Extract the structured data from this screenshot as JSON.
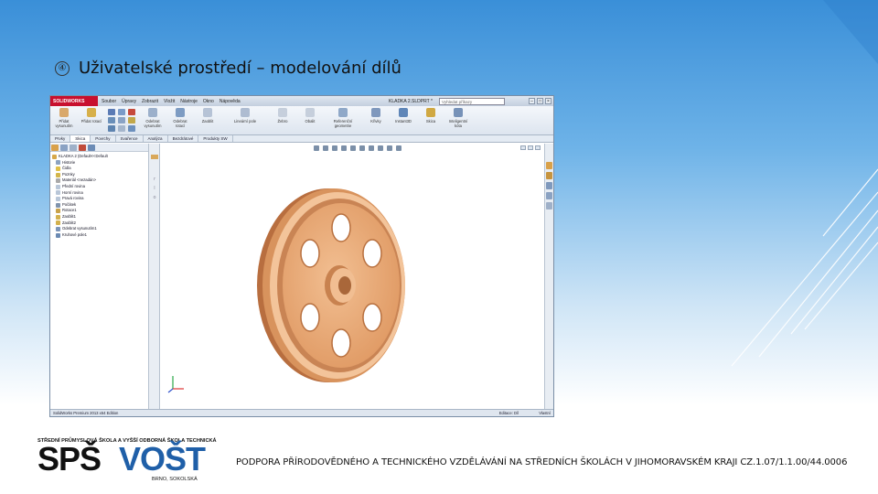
{
  "slide": {
    "bullet_glyph": "④",
    "title": "Uživatelské prostředí – modelování dílů",
    "footer": "PODPORA PŘÍRODOVĚDNÉHO A TECHNICKÉHO VZDĚLÁVÁNÍ NA STŘEDNÍCH ŠKOLÁCH V JIHOMORAVSKÉM KRAJI CZ.1.07/1.1.00/44.0006"
  },
  "logo": {
    "top_text": "STŘEDNÍ PRŮMYSLOVÁ ŠKOLA A VYŠŠÍ ODBORNÁ ŠKOLA TECHNICKÁ",
    "left_text": "SPŠ",
    "right_text": "VOŠT",
    "bottom_text": "BRNO, SOKOLSKÁ"
  },
  "solidworks": {
    "logo_text": "SOLIDWORKS",
    "menu": [
      "Soubor",
      "Úpravy",
      "Zobrazit",
      "Vložit",
      "Nástroje",
      "Okno",
      "Nápověda"
    ],
    "document_title": "KLADKA 2.SLDPRT *",
    "search_placeholder": "Vyhledat příkazy",
    "ribbon": {
      "extrude_label": "Přidat vysunutím",
      "revolve_label": "Přidat rotací",
      "cut_extrude_label": "Odebrat vysunutím",
      "cut_revolve_label": "Odebrat rotací",
      "fillet_label": "Zaoblit",
      "pattern_label": "Lineární pole",
      "rib_label": "Žebro",
      "wrap_label": "Obalit",
      "ref_geometry_label": "Referenční geometrie",
      "curves_label": "Křivky",
      "instant3d_label": "Instant3D",
      "sketch_label": "Skica",
      "smart_dim_label": "Inteligentní kóta"
    },
    "tabs": [
      "Prvky",
      "Skica",
      "Povrchy",
      "Svařence",
      "Analýza",
      "Bezdrátové",
      "Produkty SW"
    ],
    "active_tab": 1,
    "tree": [
      "KLADKA 2 (Default<<Default",
      "Historie",
      "Čidla",
      "Poznky",
      "Materiál <nezadán>",
      "Přední rovina",
      "Horní rovina",
      "Pravá rovina",
      "Počátek",
      "Rotace1",
      "Zaoblit1",
      "Zaoblit2",
      "Odebrat vysunutím1",
      "Kruhové pole1"
    ],
    "status_left": "SolidWorks Premium 2013 x64 Edition",
    "status_mid": "Editace: Díl",
    "status_right": "Vlastní"
  },
  "colors": {
    "wheel_main": "#e7a774",
    "wheel_dark": "#b86e3f",
    "wheel_light": "#f5c9a2",
    "sw_red": "#c8102e"
  }
}
